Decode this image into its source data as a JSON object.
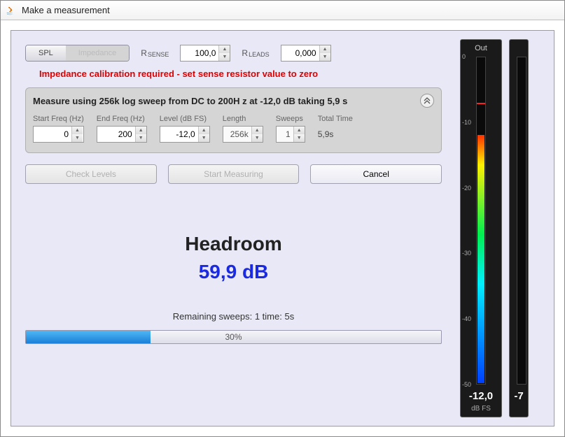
{
  "window": {
    "title": "Make a measurement"
  },
  "toggle": {
    "spl": "SPL",
    "impedance": "Impedance"
  },
  "rsense": {
    "label": "R",
    "sub": "SENSE",
    "value": "100,0"
  },
  "rleads": {
    "label": "R",
    "sub": "LEADS",
    "value": "0,000"
  },
  "warning": "Impedance calibration required - set sense resistor value to zero",
  "panel": {
    "summary": "Measure using  256k log sweep from DC to 200H z at -12,0 dB taking 5,9 s",
    "start_freq": {
      "label": "Start Freq (Hz)",
      "value": "0"
    },
    "end_freq": {
      "label": "End Freq (Hz)",
      "value": "200"
    },
    "level": {
      "label": "Level (dB FS)",
      "value": "-12,0"
    },
    "length": {
      "label": "Length",
      "value": "256k"
    },
    "sweeps": {
      "label": "Sweeps",
      "value": "1"
    },
    "total_time": {
      "label": "Total Time",
      "value": "5,9s"
    }
  },
  "buttons": {
    "check_levels": "Check Levels",
    "start_measuring": "Start Measuring",
    "cancel": "Cancel"
  },
  "headroom": {
    "title": "Headroom",
    "value": "59,9 dB"
  },
  "status": {
    "text": "Remaining sweeps: 1   time: 5s"
  },
  "progress": {
    "percent": 30,
    "label": "30%"
  },
  "meter_out": {
    "label": "Out",
    "peak": "-12,0",
    "unit": "dB FS",
    "ticks": [
      "0",
      "-10",
      "-20",
      "-30",
      "-40",
      "-50"
    ]
  },
  "meter_b": {
    "peak": "-7",
    "unit": ""
  }
}
